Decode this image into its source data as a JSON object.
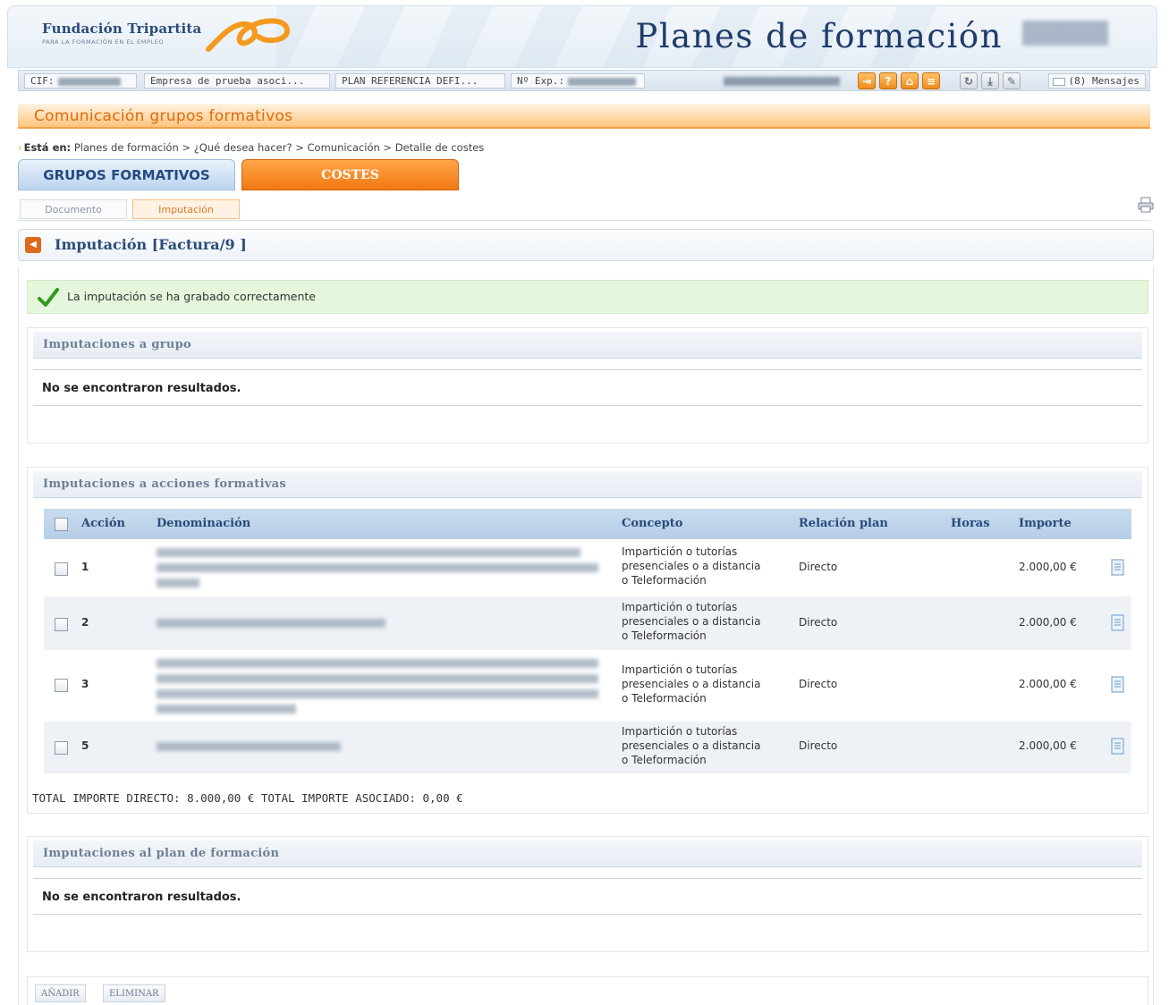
{
  "header": {
    "logo_title": "Fundación Tripartita",
    "logo_subtitle": "PARA LA FORMACIÓN EN EL EMPLEO",
    "app_title": "Planes de formación"
  },
  "infobar": {
    "cif_label": "CIF:",
    "company": "Empresa de prueba asoci...",
    "plan": "PLAN REFERENCIA DEFI...",
    "exp_label": "Nº Exp.:",
    "messages": "(8) Mensajes"
  },
  "banner": {
    "title": "Comunicación grupos formativos"
  },
  "breadcrumb": {
    "label": "Está en:",
    "path": "Planes de formación > ¿Qué desea hacer? > Comunicación > Detalle de costes"
  },
  "tabs": {
    "grupos": "GRUPOS FORMATIVOS",
    "costes": "COSTES"
  },
  "subtabs": {
    "documento": "Documento",
    "imputacion": "Imputación"
  },
  "title_panel": {
    "title": "Imputación [Factura/9 ]"
  },
  "success_message": "La imputación se ha grabado correctamente",
  "panels": {
    "grupo": {
      "title": "Imputaciones a grupo",
      "empty": "No se encontraron resultados."
    },
    "acciones": {
      "title": "Imputaciones a acciones formativas"
    },
    "plan": {
      "title": "Imputaciones al plan de formación",
      "empty": "No se encontraron resultados."
    }
  },
  "table": {
    "headers": {
      "accion": "Acción",
      "denominacion": "Denominación",
      "concepto": "Concepto",
      "relacion": "Relación plan",
      "horas": "Horas",
      "importe": "Importe"
    },
    "rows": [
      {
        "accion": "1",
        "concepto": [
          "Impartición o tutorías",
          "presenciales o a distancia",
          "o Teleformación"
        ],
        "relacion": "Directo",
        "horas": "",
        "importe": "2.000,00 €"
      },
      {
        "accion": "2",
        "concepto": [
          "Impartición o tutorías",
          "presenciales o a distancia",
          "o Teleformación"
        ],
        "relacion": "Directo",
        "horas": "",
        "importe": "2.000,00 €"
      },
      {
        "accion": "3",
        "concepto": [
          "Impartición o tutorías",
          "presenciales o a distancia",
          "o Teleformación"
        ],
        "relacion": "Directo",
        "horas": "",
        "importe": "2.000,00 €"
      },
      {
        "accion": "5",
        "concepto": [
          "Impartición o tutorías",
          "presenciales o a distancia",
          "o Teleformación"
        ],
        "relacion": "Directo",
        "horas": "",
        "importe": "2.000,00 €"
      }
    ]
  },
  "totals": "TOTAL IMPORTE DIRECTO: 8.000,00 € TOTAL IMPORTE ASOCIADO: 0,00 €",
  "buttons": {
    "add": "AÑADIR",
    "delete": "ELIMINAR"
  },
  "colors": {
    "brand_blue": "#2b4a7a",
    "accent_orange": "#f07812",
    "success_green": "#e6f6dc"
  }
}
